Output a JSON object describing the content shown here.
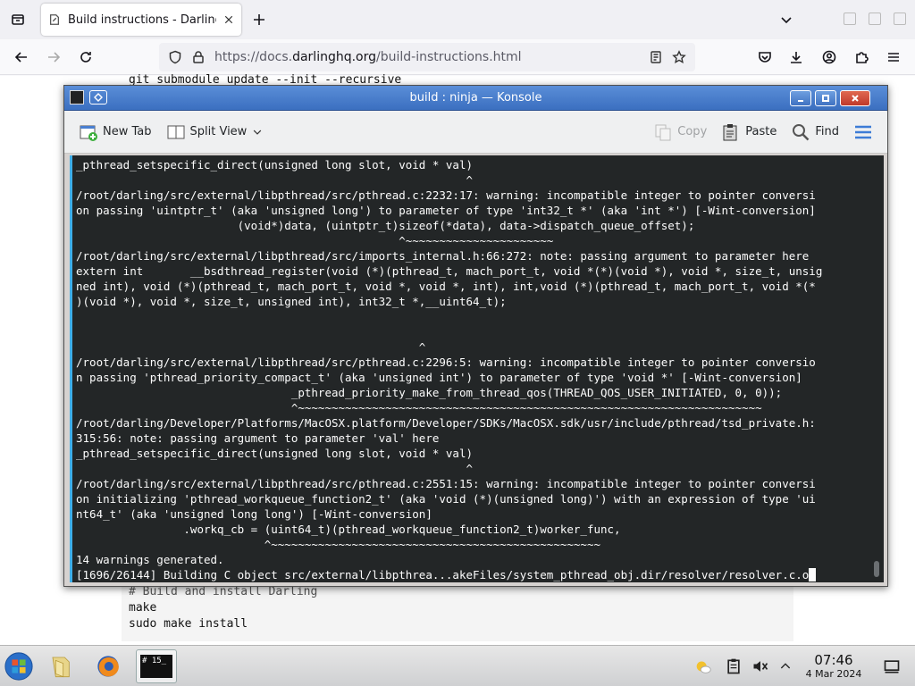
{
  "browser": {
    "tab_title": "Build instructions - Darling",
    "url_prefix": "https://docs.",
    "url_host": "darlinghq.org",
    "url_path": "/build-instructions.html"
  },
  "page": {
    "top_code_line": "git submodule update --init --recursive",
    "bottom_comment": "# Build and install Darling",
    "bottom_cmd1": "make",
    "bottom_cmd2": "sudo make install"
  },
  "konsole": {
    "title": "build : ninja — Konsole",
    "toolbar": {
      "new_tab": "New Tab",
      "split_view": "Split View",
      "copy": "Copy",
      "paste": "Paste",
      "find": "Find"
    },
    "lines": [
      "_pthread_setspecific_direct(unsigned long slot, void * val)",
      "                                                          ^",
      "/root/darling/src/external/libpthread/src/pthread.c:2232:17: warning: incompatible integer to pointer conversi",
      "on passing 'uintptr_t' (aka 'unsigned long') to parameter of type 'int32_t *' (aka 'int *') [-Wint-conversion]",
      "                        (void*)data, (uintptr_t)sizeof(*data), data->dispatch_queue_offset);",
      "                                                ^~~~~~~~~~~~~~~~~~~~~~~",
      "/root/darling/src/external/libpthread/src/imports_internal.h:66:272: note: passing argument to parameter here",
      "extern int       __bsdthread_register(void (*)(pthread_t, mach_port_t, void *(*)(void *), void *, size_t, unsig",
      "ned int), void (*)(pthread_t, mach_port_t, void *, void *, int), int,void (*)(pthread_t, mach_port_t, void *(*",
      ")(void *), void *, size_t, unsigned int), int32_t *,__uint64_t);",
      "",
      "",
      "                                                   ^",
      "/root/darling/src/external/libpthread/src/pthread.c:2296:5: warning: incompatible integer to pointer conversio",
      "n passing 'pthread_priority_compact_t' (aka 'unsigned int') to parameter of type 'void *' [-Wint-conversion]",
      "                                _pthread_priority_make_from_thread_qos(THREAD_QOS_USER_INITIATED, 0, 0));",
      "                                ^~~~~~~~~~~~~~~~~~~~~~~~~~~~~~~~~~~~~~~~~~~~~~~~~~~~~~~~~~~~~~~~~~~~~~",
      "/root/darling/Developer/Platforms/MacOSX.platform/Developer/SDKs/MacOSX.sdk/usr/include/pthread/tsd_private.h:",
      "315:56: note: passing argument to parameter 'val' here",
      "_pthread_setspecific_direct(unsigned long slot, void * val)",
      "                                                          ^",
      "/root/darling/src/external/libpthread/src/pthread.c:2551:15: warning: incompatible integer to pointer conversi",
      "on initializing 'pthread_workqueue_function2_t' (aka 'void (*)(unsigned long)') with an expression of type 'ui",
      "nt64_t' (aka 'unsigned long long') [-Wint-conversion]",
      "                .workq_cb = (uint64_t)(pthread_workqueue_function2_t)worker_func,",
      "                            ^~~~~~~~~~~~~~~~~~~~~~~~~~~~~~~~~~~~~~~~~~~~~~~~~~",
      "14 warnings generated."
    ],
    "last_line": "[1696/26144] Building C object src/external/libpthrea...akeFiles/system_pthread_obj.dir/resolver/resolver.c.o"
  },
  "taskbar": {
    "time": "07:46",
    "date": "4 Mar 2024",
    "terminal_label": "# 15_"
  }
}
